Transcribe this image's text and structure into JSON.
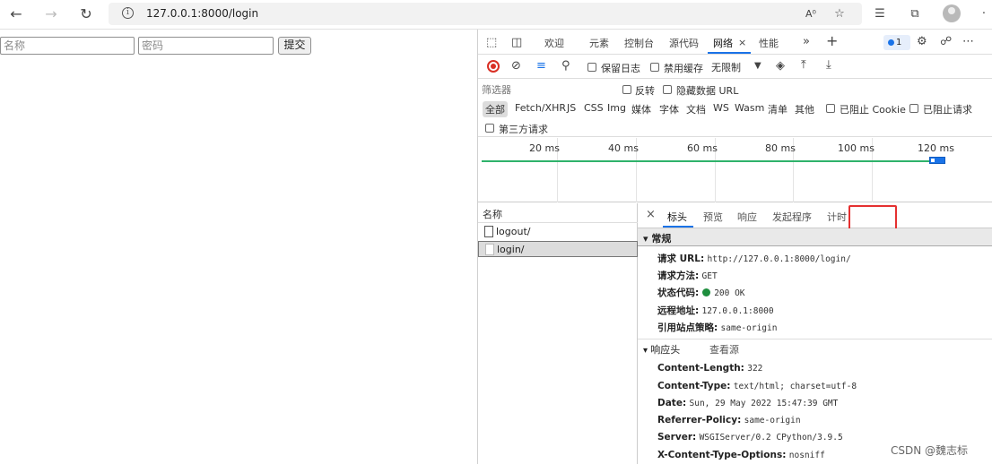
{
  "browser": {
    "url": "127.0.0.1:8000/login"
  },
  "page": {
    "username_placeholder": "名称",
    "password_placeholder": "密码",
    "submit_label": "提交"
  },
  "devtools": {
    "tabs": [
      "欢迎",
      "元素",
      "控制台",
      "源代码",
      "网络",
      "性能"
    ],
    "active_tab": "网络",
    "issues_count": "1",
    "toolbar": {
      "preserve_log": "保留日志",
      "disable_cache": "禁用缓存",
      "throttling": "无限制"
    },
    "filter": {
      "placeholder": "筛选器",
      "invert": "反转",
      "hide_data_urls": "隐藏数据 URL",
      "types": [
        "全部",
        "Fetch/XHR",
        "JS",
        "CSS",
        "Img",
        "媒体",
        "字体",
        "文档",
        "WS",
        "Wasm",
        "清单",
        "其他"
      ],
      "blocked_cookies": "已阻止 Cookie",
      "blocked_requests": "已阻止请求",
      "third_party": "第三方请求"
    },
    "timeline_ticks": [
      "20 ms",
      "40 ms",
      "60 ms",
      "80 ms",
      "100 ms",
      "120 ms"
    ],
    "requests_header": "名称",
    "requests": [
      "logout/",
      "login/"
    ],
    "detail_tabs": [
      "标头",
      "预览",
      "响应",
      "发起程序",
      "计时"
    ],
    "general": {
      "title": "常规",
      "request_url_label": "请求 URL:",
      "request_url": "http://127.0.0.1:8000/login/",
      "method_label": "请求方法:",
      "method": "GET",
      "status_label": "状态代码:",
      "status": "200 OK",
      "remote_label": "远程地址:",
      "remote": "127.0.0.1:8000",
      "referrer_label": "引用站点策略:",
      "referrer": "same-origin"
    },
    "response_headers": {
      "title": "响应头",
      "view_source": "查看源",
      "items": [
        {
          "key": "Content-Length:",
          "value": "322"
        },
        {
          "key": "Content-Type:",
          "value": "text/html; charset=utf-8"
        },
        {
          "key": "Date:",
          "value": "Sun, 29 May 2022 15:47:39 GMT"
        },
        {
          "key": "Referrer-Policy:",
          "value": "same-origin"
        },
        {
          "key": "Server:",
          "value": "WSGIServer/0.2 CPython/3.9.5"
        },
        {
          "key": "X-Content-Type-Options:",
          "value": "nosniff"
        }
      ]
    }
  },
  "watermark": "CSDN @魏志标"
}
